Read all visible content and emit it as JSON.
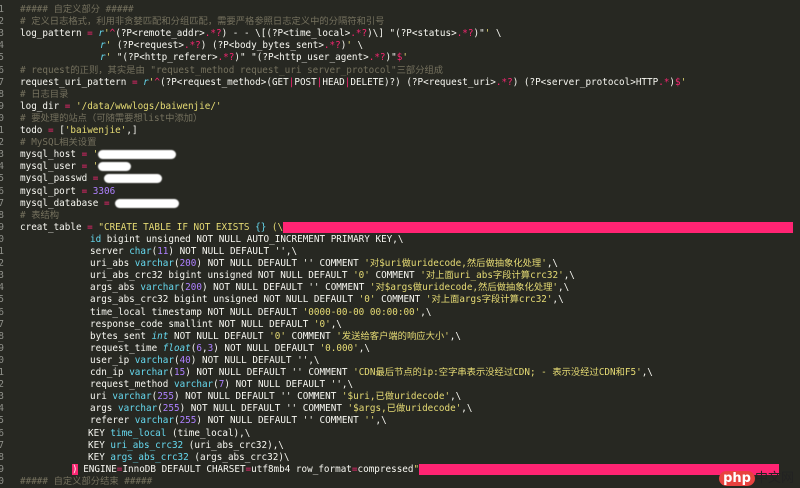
{
  "editor": {
    "background": "#272822",
    "lines": [
      [
        [
          "c",
          "##### 自定义部分 #####"
        ]
      ],
      [
        [
          "c",
          "# 定义日志格式，利用非贪婪匹配和分组匹配，需要严格参照日志定义中的分隔符和引号"
        ]
      ],
      [
        [
          "p",
          "log_pattern "
        ],
        [
          "k",
          "="
        ],
        [
          "p",
          " "
        ],
        [
          "i",
          "r"
        ],
        [
          "s",
          "'"
        ],
        [
          "k",
          "^"
        ],
        [
          "p",
          "(?P<remote_addr>"
        ],
        [
          "k",
          ".*?"
        ],
        [
          "p",
          ") - - \\[(?P<time_local>"
        ],
        [
          "k",
          ".*?"
        ],
        [
          "p",
          ")\\] \"(?P<status>"
        ],
        [
          "k",
          ".*?"
        ],
        [
          "p",
          ")\""
        ],
        [
          "s",
          "'"
        ],
        [
          "p",
          " \\"
        ]
      ],
      [
        [
          "i",
          "r"
        ],
        [
          "s",
          "'"
        ],
        [
          "p",
          " (?P<request>"
        ],
        [
          "k",
          ".*?"
        ],
        [
          "p",
          ") (?P<body_bytes_sent>"
        ],
        [
          "k",
          ".*?"
        ],
        [
          "p",
          ")"
        ],
        [
          "s",
          "'"
        ],
        [
          "p",
          " \\"
        ]
      ],
      [
        [
          "i",
          "r"
        ],
        [
          "s",
          "'"
        ],
        [
          "p",
          " \"(?P<http_referer>"
        ],
        [
          "k",
          ".*?"
        ],
        [
          "p",
          ")\" \"(?P<http_user_agent>"
        ],
        [
          "k",
          ".*?"
        ],
        [
          "p",
          ")\""
        ],
        [
          "k",
          "$"
        ],
        [
          "s",
          "'"
        ]
      ],
      [
        [
          "c",
          "# request的正则，其实是由 \"request_method request_uri server_protocol\"三部分组成"
        ]
      ],
      [
        [
          "p",
          "request_uri_pattern "
        ],
        [
          "k",
          "="
        ],
        [
          "p",
          " "
        ],
        [
          "i",
          "r"
        ],
        [
          "s",
          "'"
        ],
        [
          "k",
          "^"
        ],
        [
          "p",
          "(?P<request_method>(GET"
        ],
        [
          "k",
          "|"
        ],
        [
          "p",
          "POST"
        ],
        [
          "k",
          "|"
        ],
        [
          "p",
          "HEAD"
        ],
        [
          "k",
          "|"
        ],
        [
          "p",
          "DELETE)?) (?P<request_uri>"
        ],
        [
          "k",
          ".*?"
        ],
        [
          "p",
          ") (?P<server_protocol>HTTP"
        ],
        [
          "k",
          ".*"
        ],
        [
          "p",
          ")"
        ],
        [
          "k",
          "$"
        ],
        [
          "s",
          "'"
        ]
      ],
      [
        [
          "c",
          "# 日志目录"
        ]
      ],
      [
        [
          "p",
          "log_dir "
        ],
        [
          "k",
          "="
        ],
        [
          "p",
          " "
        ],
        [
          "s",
          "'/data/wwwlogs/baiwenjie/'"
        ]
      ],
      [
        [
          "c",
          "# 要处理的站点（可随需要想list中添加）"
        ]
      ],
      [
        [
          "p",
          "todo "
        ],
        [
          "k",
          "="
        ],
        [
          "p",
          " ["
        ],
        [
          "s",
          "'baiwenjie'"
        ],
        [
          "p",
          ",]"
        ]
      ],
      [
        [
          "c",
          "# MySQL相关设置"
        ]
      ],
      [
        [
          "p",
          "mysql_host "
        ],
        [
          "k",
          "="
        ],
        [
          "p",
          " "
        ],
        [
          "s",
          "'"
        ],
        [
          "r",
          "78"
        ]
      ],
      [
        [
          "p",
          "mysql_user "
        ],
        [
          "k",
          "="
        ],
        [
          "p",
          " "
        ],
        [
          "s",
          "'"
        ],
        [
          "r",
          "33"
        ]
      ],
      [
        [
          "p",
          "mysql_passwd "
        ],
        [
          "k",
          "="
        ],
        [
          "p",
          " "
        ],
        [
          "r",
          "58"
        ]
      ],
      [
        [
          "p",
          "mysql_port "
        ],
        [
          "k",
          "="
        ],
        [
          "p",
          " "
        ],
        [
          "n",
          "3306"
        ]
      ],
      [
        [
          "p",
          "mysql_database "
        ],
        [
          "k",
          "="
        ],
        [
          "p",
          " "
        ],
        [
          "r",
          "64"
        ]
      ],
      [
        [
          "c",
          "# 表结构"
        ]
      ],
      [
        [
          "p",
          "creat_table "
        ],
        [
          "k",
          "="
        ],
        [
          "p",
          " "
        ],
        [
          "s",
          "\"CREATE TABLE IF NOT EXISTS "
        ],
        [
          "f",
          "{}"
        ],
        [
          "s",
          " (\\"
        ],
        [
          "b",
          "510"
        ]
      ],
      [
        [
          "f",
          "id"
        ],
        [
          "p",
          " bigint unsigned NOT NULL AUTO_INCREMENT PRIMARY KEY,\\"
        ]
      ],
      [
        [
          "p",
          "server "
        ],
        [
          "f",
          "char"
        ],
        [
          "p",
          "("
        ],
        [
          "n",
          "11"
        ],
        [
          "p",
          ") NOT NULL DEFAULT '',\\"
        ]
      ],
      [
        [
          "p",
          "uri_abs "
        ],
        [
          "f",
          "varchar"
        ],
        [
          "p",
          "("
        ],
        [
          "n",
          "200"
        ],
        [
          "p",
          ") NOT NULL DEFAULT '' COMMENT "
        ],
        [
          "s",
          "'对$uri做uridecode,然后做抽象化处理'"
        ],
        [
          "p",
          ",\\"
        ]
      ],
      [
        [
          "p",
          "uri_abs_crc32 bigint unsigned NOT NULL DEFAULT "
        ],
        [
          "s",
          "'0'"
        ],
        [
          "p",
          " COMMENT "
        ],
        [
          "s",
          "'对上面uri_abs字段计算crc32'"
        ],
        [
          "p",
          ",\\"
        ]
      ],
      [
        [
          "p",
          "args_abs "
        ],
        [
          "f",
          "varchar"
        ],
        [
          "p",
          "("
        ],
        [
          "n",
          "200"
        ],
        [
          "p",
          ") NOT NULL DEFAULT '' COMMENT "
        ],
        [
          "s",
          "'对$args做uridecode,然后做抽象化处理'"
        ],
        [
          "p",
          ",\\"
        ]
      ],
      [
        [
          "p",
          "args_abs_crc32 bigint unsigned NOT NULL DEFAULT "
        ],
        [
          "s",
          "'0'"
        ],
        [
          "p",
          " COMMENT "
        ],
        [
          "s",
          "'对上面args字段计算crc32'"
        ],
        [
          "p",
          ",\\"
        ]
      ],
      [
        [
          "p",
          "time_local timestamp NOT NULL DEFAULT "
        ],
        [
          "s",
          "'0000-00-00 00:00:00'"
        ],
        [
          "p",
          ",\\"
        ]
      ],
      [
        [
          "p",
          "response_code smallint NOT NULL DEFAULT "
        ],
        [
          "s",
          "'0'"
        ],
        [
          "p",
          ",\\"
        ]
      ],
      [
        [
          "p",
          "bytes_sent "
        ],
        [
          "i",
          "int"
        ],
        [
          "p",
          " NOT NULL DEFAULT "
        ],
        [
          "s",
          "'0'"
        ],
        [
          "p",
          " COMMENT "
        ],
        [
          "s",
          "'发送给客户端的响应大小'"
        ],
        [
          "p",
          ",\\"
        ]
      ],
      [
        [
          "p",
          "request_time "
        ],
        [
          "i",
          "float"
        ],
        [
          "p",
          "("
        ],
        [
          "n",
          "6"
        ],
        [
          "p",
          ","
        ],
        [
          "n",
          "3"
        ],
        [
          "p",
          ") NOT NULL DEFAULT "
        ],
        [
          "s",
          "'0.000'"
        ],
        [
          "p",
          ",\\"
        ]
      ],
      [
        [
          "p",
          "user_ip "
        ],
        [
          "f",
          "varchar"
        ],
        [
          "p",
          "("
        ],
        [
          "n",
          "40"
        ],
        [
          "p",
          ") NOT NULL DEFAULT '',\\"
        ]
      ],
      [
        [
          "p",
          "cdn_ip "
        ],
        [
          "f",
          "varchar"
        ],
        [
          "p",
          "("
        ],
        [
          "n",
          "15"
        ],
        [
          "p",
          ") NOT NULL DEFAULT '' COMMENT "
        ],
        [
          "s",
          "'CDN最后节点的ip:空字串表示没经过CDN; - 表示没经过CDN和F5'"
        ],
        [
          "p",
          ",\\"
        ]
      ],
      [
        [
          "p",
          "request_method "
        ],
        [
          "f",
          "varchar"
        ],
        [
          "p",
          "("
        ],
        [
          "n",
          "7"
        ],
        [
          "p",
          ") NOT NULL DEFAULT '',\\"
        ]
      ],
      [
        [
          "p",
          "uri "
        ],
        [
          "f",
          "varchar"
        ],
        [
          "p",
          "("
        ],
        [
          "n",
          "255"
        ],
        [
          "p",
          ") NOT NULL DEFAULT '' COMMENT "
        ],
        [
          "s",
          "'$uri,已做uridecode'"
        ],
        [
          "p",
          ",\\"
        ]
      ],
      [
        [
          "p",
          "args "
        ],
        [
          "f",
          "varchar"
        ],
        [
          "p",
          "("
        ],
        [
          "n",
          "255"
        ],
        [
          "p",
          ") NOT NULL DEFAULT '' COMMENT "
        ],
        [
          "s",
          "'$args,已做uridecode'"
        ],
        [
          "p",
          ",\\"
        ]
      ],
      [
        [
          "p",
          "referer "
        ],
        [
          "f",
          "varchar"
        ],
        [
          "p",
          "("
        ],
        [
          "n",
          "255"
        ],
        [
          "p",
          ") NOT NULL DEFAULT '' COMMENT "
        ],
        [
          "s",
          "''"
        ],
        [
          "p",
          ",\\"
        ]
      ],
      [
        [
          "p",
          "KEY "
        ],
        [
          "f",
          "time_local"
        ],
        [
          "p",
          " (time_local),\\"
        ]
      ],
      [
        [
          "p",
          "KEY "
        ],
        [
          "f",
          "uri_abs_crc32"
        ],
        [
          "p",
          " (uri_abs_crc32),\\"
        ]
      ],
      [
        [
          "p",
          "KEY "
        ],
        [
          "f",
          "args_abs_crc32"
        ],
        [
          "p",
          " (args_abs_crc32)\\"
        ]
      ],
      [
        [
          "h",
          ")"
        ],
        [
          "p",
          " ENGINE"
        ],
        [
          "k",
          "="
        ],
        [
          "p",
          "InnoDB DEFAULT CHARSET"
        ],
        [
          "k",
          "="
        ],
        [
          "p",
          "utf8mb4 row_format"
        ],
        [
          "k",
          "="
        ],
        [
          "p",
          "compressed"
        ],
        [
          "s",
          "\""
        ],
        [
          "b",
          "360"
        ]
      ],
      [
        [
          "c",
          "##### 自定义部分结束 #####"
        ]
      ]
    ]
  },
  "watermark": {
    "logo": "php",
    "text": "中文网"
  }
}
